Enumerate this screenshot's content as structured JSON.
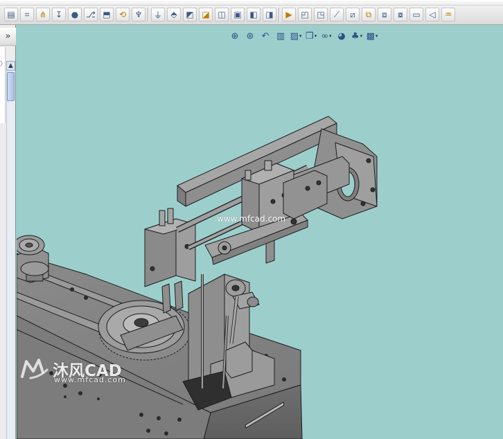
{
  "toolbar": {
    "buttons": [
      {
        "icon": "sketch-icon",
        "glyph": "▤"
      },
      {
        "icon": "smart-dimension-icon",
        "glyph": "⌗"
      },
      {
        "icon": "pattern-icon",
        "glyph": "⋔"
      },
      {
        "icon": "move-icon",
        "glyph": "↧"
      },
      {
        "icon": "apple-icon",
        "glyph": "●"
      },
      {
        "icon": "mirror-icon",
        "glyph": "⎇"
      },
      {
        "icon": "extrude-icon",
        "glyph": "⬒"
      },
      {
        "icon": "revolve-icon",
        "glyph": "⟲"
      },
      {
        "icon": "sweep-icon",
        "glyph": "♆"
      },
      {
        "icon": "thermometer-icon",
        "glyph": "⏚"
      },
      {
        "icon": "loft-icon",
        "glyph": "⬘"
      },
      {
        "icon": "fillet-icon",
        "glyph": "◩"
      },
      {
        "icon": "chamfer-icon",
        "glyph": "◪"
      },
      {
        "icon": "rib-icon",
        "glyph": "◫"
      },
      {
        "icon": "shell-icon",
        "glyph": "▣"
      },
      {
        "icon": "draft-icon",
        "glyph": "◧"
      },
      {
        "icon": "hole-icon",
        "glyph": "◨"
      },
      {
        "icon": "play-icon",
        "glyph": "▶"
      },
      {
        "icon": "wrap-icon",
        "glyph": "◰"
      },
      {
        "icon": "dome-icon",
        "glyph": "◳"
      },
      {
        "icon": "split-icon",
        "glyph": "⟋"
      },
      {
        "icon": "combine-icon",
        "glyph": "⧄"
      },
      {
        "icon": "intersect-icon",
        "glyph": "⧉"
      },
      {
        "icon": "assembly-icon",
        "glyph": "⧈"
      },
      {
        "icon": "mate-icon",
        "glyph": "⧇"
      },
      {
        "icon": "explode-icon",
        "glyph": "▭"
      },
      {
        "icon": "section-icon",
        "glyph": "◁"
      },
      {
        "icon": "simulation-icon",
        "glyph": "♒"
      }
    ]
  },
  "leftpane": {
    "expand_glyph": "»",
    "scroll_up_glyph": "▲",
    "side_arrow": "〉"
  },
  "hud": {
    "buttons": [
      {
        "icon": "zoom-to-fit-icon",
        "glyph": "⊕",
        "dropdown": false
      },
      {
        "icon": "zoom-to-area-icon",
        "glyph": "⊛",
        "dropdown": false
      },
      {
        "icon": "previous-view-icon",
        "glyph": "↶",
        "dropdown": false
      },
      {
        "icon": "section-view-icon",
        "glyph": "▥",
        "dropdown": false
      },
      {
        "icon": "view-orientation-icon",
        "glyph": "▨",
        "dropdown": true
      },
      {
        "icon": "display-style-icon",
        "glyph": "❒",
        "dropdown": true
      },
      {
        "icon": "hide-show-items-icon",
        "glyph": "∞",
        "dropdown": true
      },
      {
        "icon": "edit-appearance-icon",
        "glyph": "◕",
        "dropdown": false
      },
      {
        "icon": "apply-scene-icon",
        "glyph": "♣",
        "dropdown": true
      },
      {
        "icon": "view-settings-icon",
        "glyph": "▩",
        "dropdown": true
      }
    ],
    "dropdown_glyph": "▾"
  },
  "viewport": {
    "background": "#9ccfcc",
    "model_color": "#8e8e8e",
    "edge_color": "#1c1c1c"
  },
  "watermark": {
    "url_text": "www.mfcad.com",
    "brand_text": "沐风CAD",
    "sub_text": "www.mfcad.com"
  }
}
